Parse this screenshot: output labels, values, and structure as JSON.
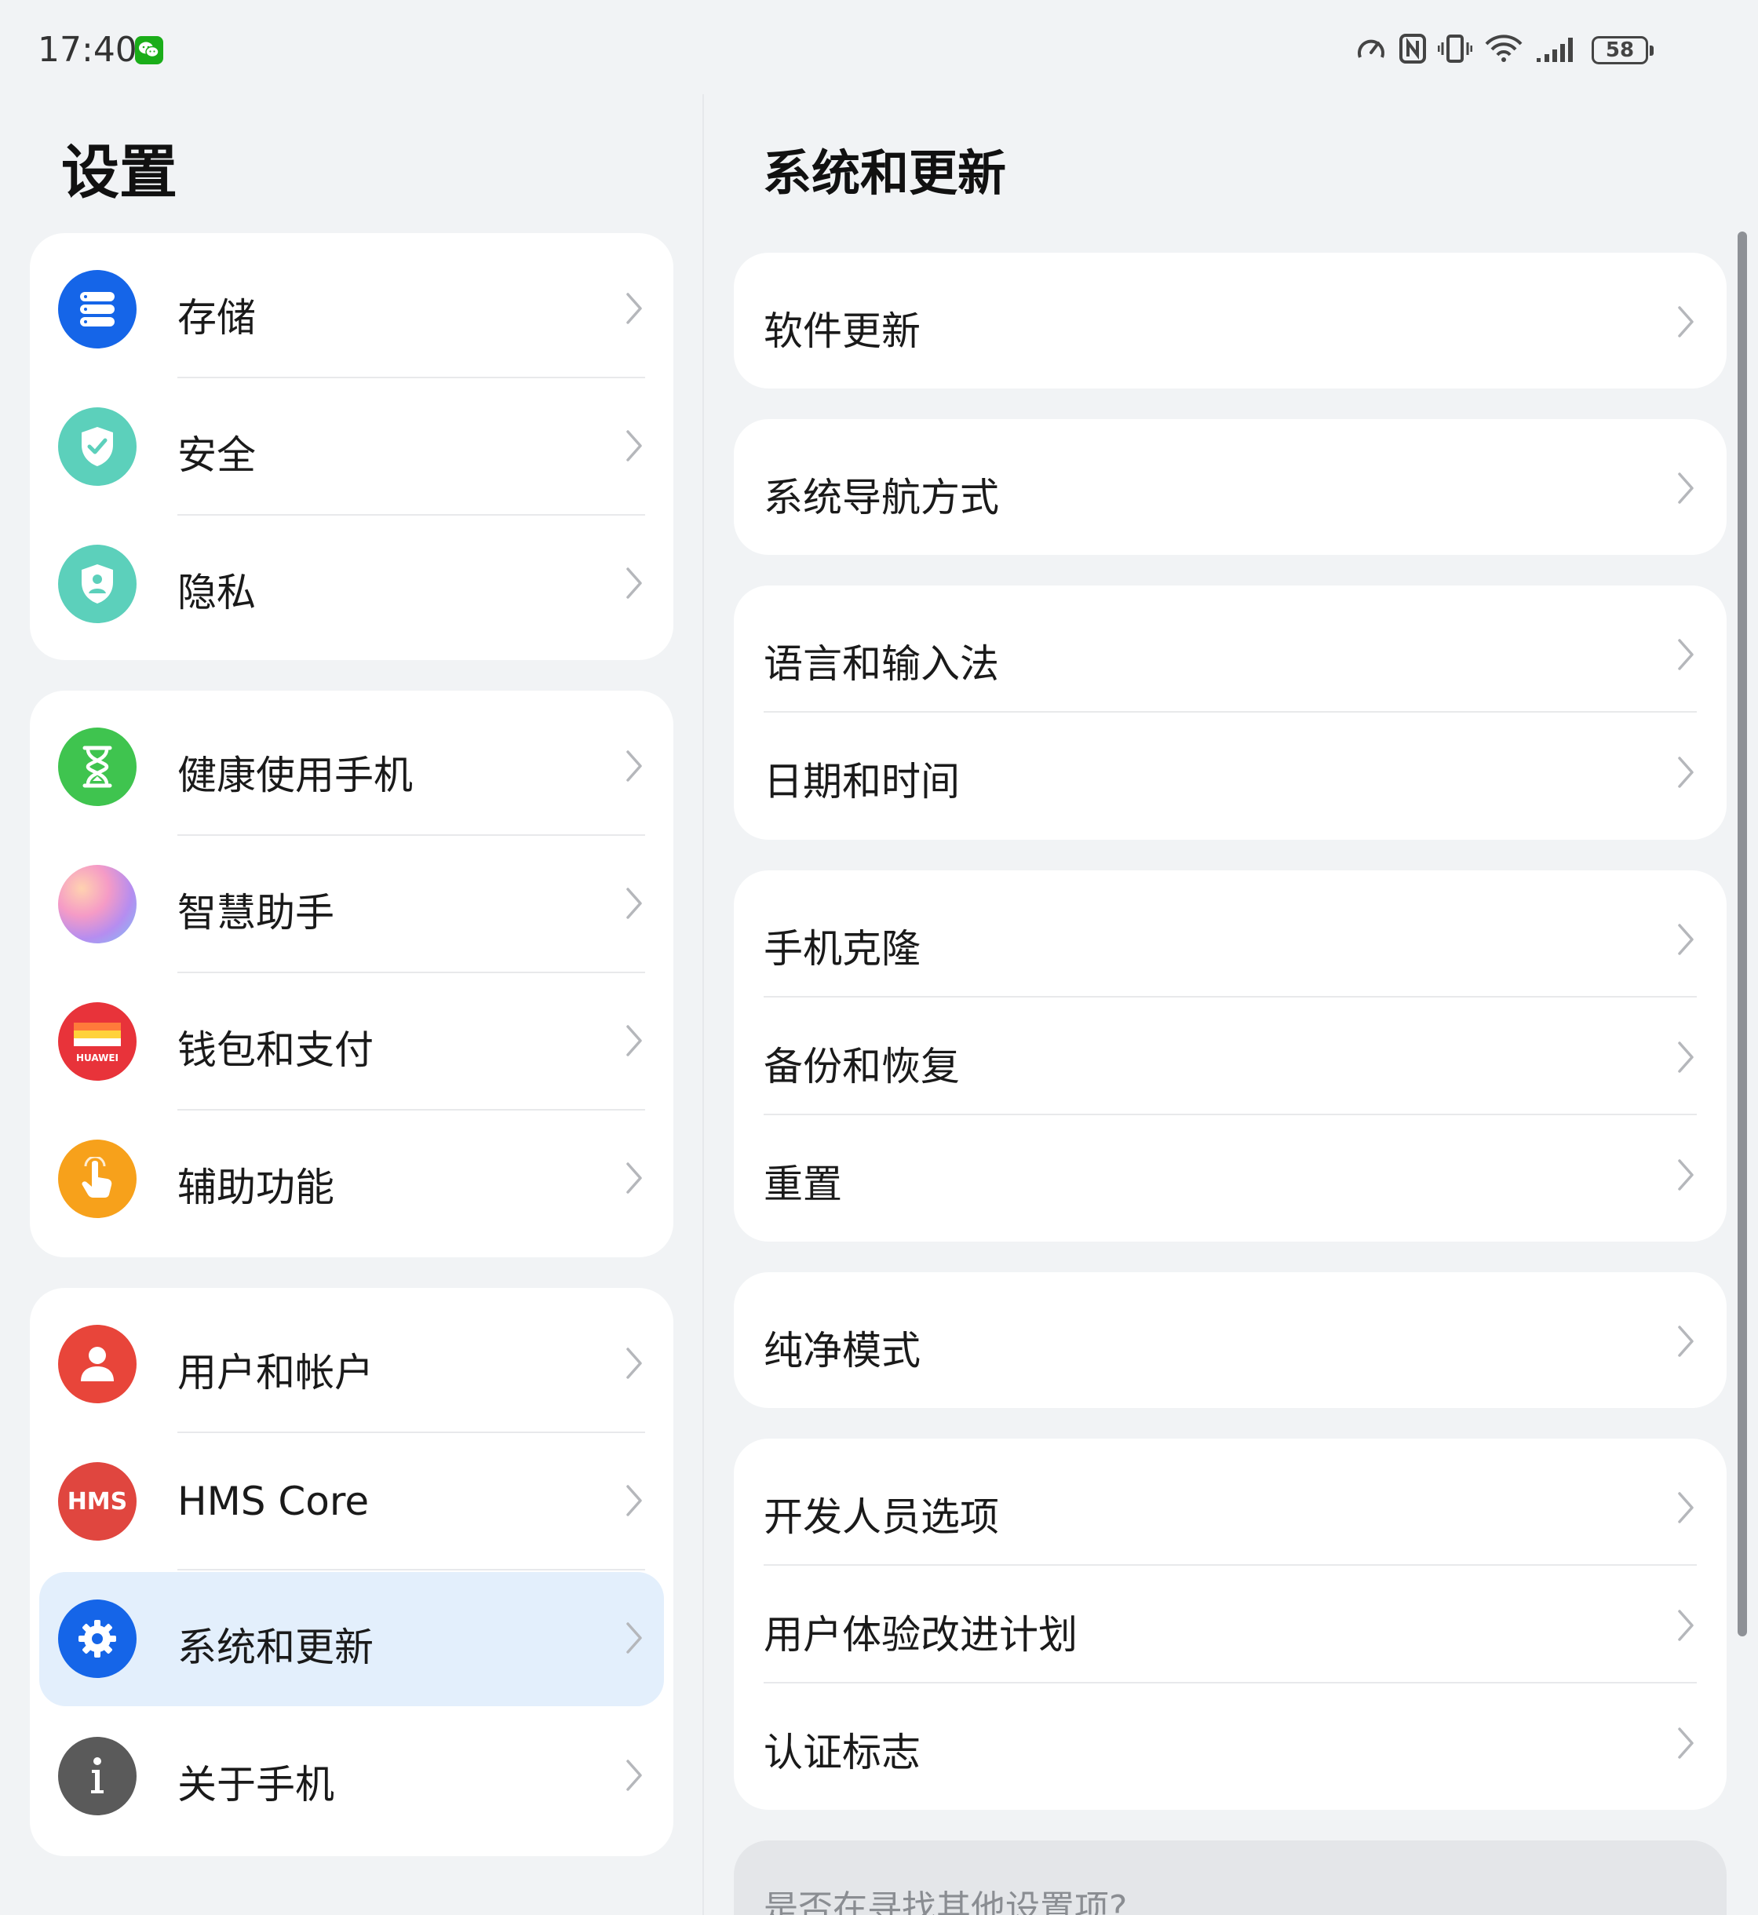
{
  "status_bar": {
    "time": "17:40",
    "battery": "58"
  },
  "left": {
    "title": "设置",
    "groups": [
      {
        "items": [
          {
            "label": "存储",
            "icon": "storage-icon",
            "color": "#1565e8"
          },
          {
            "label": "安全",
            "icon": "shield-check-icon",
            "color": "#4cc6b0"
          },
          {
            "label": "隐私",
            "icon": "privacy-shield-icon",
            "color": "#4cc6b0"
          }
        ]
      },
      {
        "items": [
          {
            "label": "健康使用手机",
            "icon": "hourglass-icon",
            "color": "#39c24a"
          },
          {
            "label": "智慧助手",
            "icon": "assistant-orb-icon",
            "color": "#f3a1c8"
          },
          {
            "label": "钱包和支付",
            "icon": "wallet-icon",
            "color": "#e8333a"
          },
          {
            "label": "辅助功能",
            "icon": "hand-pointer-icon",
            "color": "#f7a11b"
          }
        ]
      },
      {
        "items": [
          {
            "label": "用户和帐户",
            "icon": "user-icon",
            "color": "#e8453a"
          },
          {
            "label": "HMS Core",
            "icon": "hms-icon",
            "color": "#e0463f"
          },
          {
            "label": "系统和更新",
            "icon": "gear-icon",
            "color": "#1565e8",
            "selected": true
          },
          {
            "label": "关于手机",
            "icon": "info-icon",
            "color": "#5a5a5a"
          }
        ]
      }
    ],
    "wallet_brand": "HUAWEI",
    "hms_text": "HMS"
  },
  "right": {
    "title": "系统和更新",
    "groups": [
      {
        "items": [
          "软件更新"
        ]
      },
      {
        "items": [
          "系统导航方式"
        ]
      },
      {
        "items": [
          "语言和输入法",
          "日期和时间"
        ]
      },
      {
        "items": [
          "手机克隆",
          "备份和恢复",
          "重置"
        ]
      },
      {
        "items": [
          "纯净模式"
        ]
      },
      {
        "items": [
          "开发人员选项",
          "用户体验改进计划",
          "认证标志"
        ]
      }
    ],
    "hint": "是否在寻找其他设置项?"
  }
}
